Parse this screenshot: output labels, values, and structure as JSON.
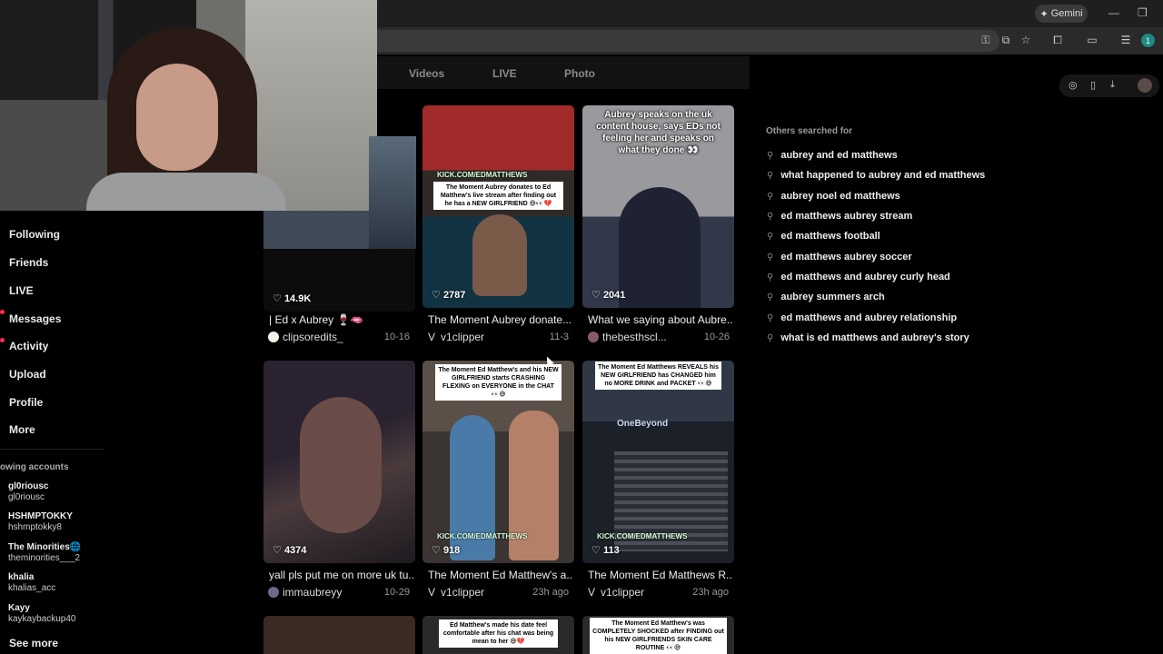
{
  "browser": {
    "gemini_label": "Gemini",
    "profile_initial": "1"
  },
  "tabs": [
    "Videos",
    "LIVE",
    "Photo"
  ],
  "nav": [
    {
      "label": "Following",
      "dot": false
    },
    {
      "label": "Friends",
      "dot": false
    },
    {
      "label": "LIVE",
      "dot": false
    },
    {
      "label": "Messages",
      "dot": true
    },
    {
      "label": "Activity",
      "dot": true
    },
    {
      "label": "Upload",
      "dot": false
    },
    {
      "label": "Profile",
      "dot": false
    },
    {
      "label": "More",
      "dot": false
    }
  ],
  "following_header": "owing accounts",
  "accounts": [
    {
      "name": "gl0riousc",
      "handle": "gl0riousc"
    },
    {
      "name": "HSHMPTOKKY",
      "handle": "hshmptokky8"
    },
    {
      "name": "The Minorities🌐",
      "handle": "theminorities___2"
    },
    {
      "name": "khalia",
      "handle": "khalias_acc"
    },
    {
      "name": "Kayy",
      "handle": "kaykaybackup40"
    }
  ],
  "see_more": "See more",
  "videos": [
    {
      "likes": "14.9K",
      "title": "| Ed x Aubrey 🍷🫦",
      "author": "clipsoredits_",
      "date": "10-16"
    },
    {
      "likes": "2787",
      "title": "The Moment Aubrey donate...",
      "author": "v1clipper",
      "date": "11-3",
      "kick": "KICK.COM/EDMATTHEWS",
      "caption": "The Moment Aubrey donates to Ed Matthew's live stream after finding out he has a NEW GIRLFRIEND 😅👀💔"
    },
    {
      "likes": "2041",
      "title": "What we saying about Aubre...",
      "author": "thebesthscl...",
      "date": "10-26",
      "overtext": "Aubrey speaks on the uk content house, says EDs not feeling her and speaks on what they done 👀"
    },
    {
      "likes": "4374",
      "title": "yall pls put me on more uk tu...",
      "author": "immaubreyy",
      "date": "10-29"
    },
    {
      "likes": "918",
      "title": "The Moment Ed Matthew's a...",
      "author": "v1clipper",
      "date": "23h ago",
      "kick": "KICK.COM/EDMATTHEWS",
      "caption": "The Moment Ed Matthew's and his NEW GIRLFRIEND starts CRASHING FLEXING on EVERYONE in the CHAT 👀😅"
    },
    {
      "likes": "113",
      "title": "The Moment Ed Matthews R...",
      "author": "v1clipper",
      "date": "23h ago",
      "kick": "KICK.COM/EDMATTHEWS",
      "caption": "The Moment Ed Matthews REVEALS his NEW GIRLFRIEND has CHANGED him no MORE DRINK and PACKET 👀😅",
      "sign": "OneBeyond"
    }
  ],
  "bottom_captions": [
    "Ed Matthew's made his date feel comfortable after his chat was being mean to her 😅💔",
    "The Moment Ed Matthew's was COMPLETELY SHOCKED after FINDING out his NEW GIRLFRIENDS SKIN CARE ROUTINE 👀😅"
  ],
  "others_header": "Others searched for",
  "suggestions": [
    "aubrey and ed matthews",
    "what happened to aubrey and ed matthews",
    "aubrey noel ed matthews",
    "ed matthews aubrey stream",
    "ed matthews football",
    "ed matthews aubrey soccer",
    "ed matthews and aubrey curly head",
    "aubrey summers arch",
    "ed matthews and aubrey relationship",
    "what is ed matthews and aubrey's story"
  ]
}
